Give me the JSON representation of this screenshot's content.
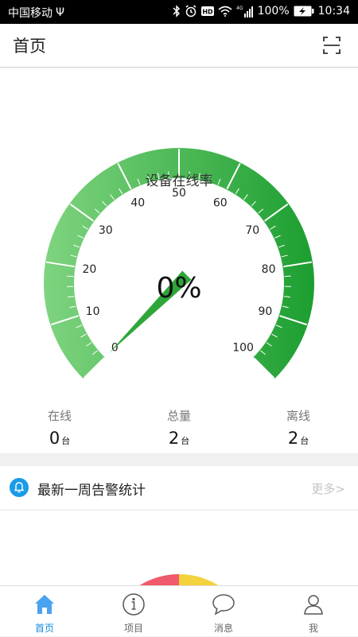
{
  "status_bar": {
    "carrier": "中国移动",
    "usb": "Ψ",
    "network": "4G",
    "battery": "100%",
    "time": "10:34",
    "icons": [
      "usb-icon",
      "bluetooth-icon",
      "alarm-icon",
      "hd-icon",
      "wifi-icon",
      "signal-icon",
      "battery-charging-icon"
    ]
  },
  "header": {
    "title": "首页",
    "scan_icon": "scan-icon"
  },
  "gauge": {
    "title": "设备在线率",
    "value": 0,
    "value_text": "0%",
    "min": 0,
    "max": 100,
    "ticks": [
      "0",
      "10",
      "20",
      "30",
      "40",
      "50",
      "60",
      "70",
      "80",
      "90",
      "100"
    ],
    "colors": {
      "start": "#7fd47f",
      "end": "#1c9e30",
      "needle": "#2fa63a"
    }
  },
  "stats": [
    {
      "label": "在线",
      "value": "0",
      "unit": "台"
    },
    {
      "label": "总量",
      "value": "2",
      "unit": "台"
    },
    {
      "label": "离线",
      "value": "2",
      "unit": "台"
    }
  ],
  "alarm": {
    "title": "最新一周告警统计",
    "more": "更多>",
    "bell_icon": "bell-icon",
    "colors": {
      "red": "#f05a6a",
      "yellow": "#f4d23c"
    }
  },
  "tabbar": {
    "active_color": "#1a8be0",
    "tabs": [
      {
        "label": "首页",
        "icon": "home-icon",
        "active": true
      },
      {
        "label": "项目",
        "icon": "info-icon",
        "active": false
      },
      {
        "label": "消息",
        "icon": "chat-bubble-icon",
        "active": false
      },
      {
        "label": "我",
        "icon": "user-icon",
        "active": false
      }
    ]
  }
}
